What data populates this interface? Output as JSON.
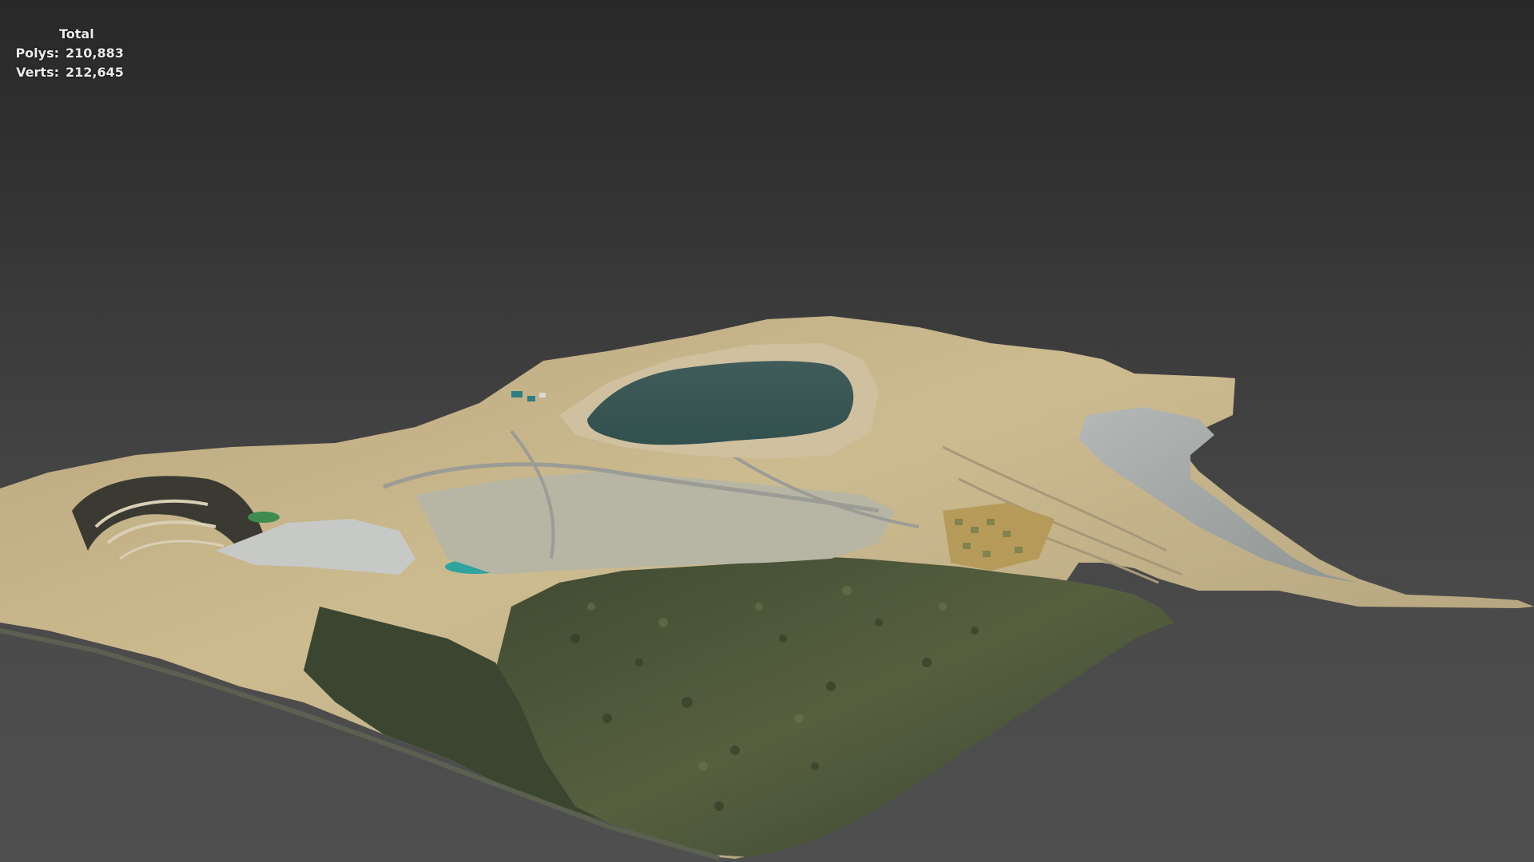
{
  "viewport": {
    "background_top": "#292929",
    "background_bottom": "#4f4f4f"
  },
  "stats": {
    "header": "Total",
    "polys_label": "Polys:",
    "polys_value": "210,883",
    "verts_label": "Verts:",
    "verts_value": "212,645"
  },
  "scene": {
    "object": "terrain-mesh",
    "colors": {
      "pit_lake": "#3d5a57",
      "forest": "#4c5a3a",
      "mine_soil": "#c9b58a",
      "tailings": "#a9adab",
      "teal_pond": "#2fa3a0",
      "green_pond": "#3e8d4e"
    }
  }
}
